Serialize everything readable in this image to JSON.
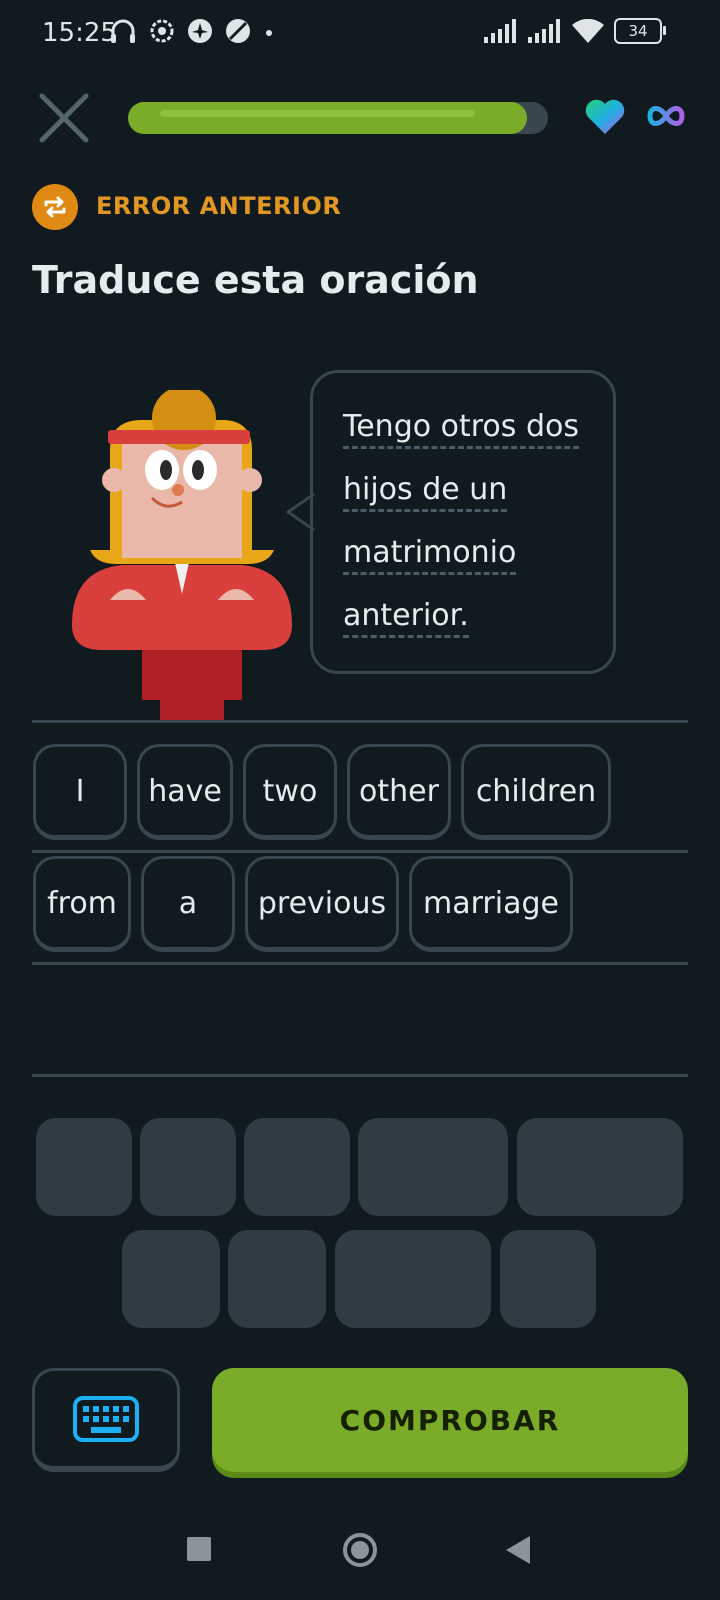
{
  "status_bar": {
    "time": "15:25",
    "battery": "34",
    "icons": [
      "headphones-icon",
      "settings-sync-icon",
      "airplane-mode-icon",
      "no-data-icon",
      "dot-icon",
      "signal-icon",
      "signal-icon",
      "wifi-icon",
      "battery-icon"
    ]
  },
  "top_bar": {
    "progress_fraction": 0.95,
    "icons": [
      "close-icon",
      "heart-icon",
      "infinity-icon"
    ],
    "colors": {
      "progress": "#7aac2a",
      "track": "#37464f"
    }
  },
  "header": {
    "badge_label": "ERROR ANTERIOR",
    "title": "Traduce esta oración",
    "badge_color": "#e08a15"
  },
  "prompt": {
    "lines": [
      "Tengo otros dos",
      "hijos de un",
      "matrimonio",
      "anterior."
    ]
  },
  "answer": {
    "row1": [
      "I",
      "have",
      "two",
      "other",
      "children"
    ],
    "row2": [
      "from",
      "a",
      "previous",
      "marriage"
    ]
  },
  "bottom": {
    "check_label": "COMPROBAR",
    "keyboard_icon": "keyboard-icon",
    "check_color": "#7aac2a"
  },
  "nav_bar": {
    "icons": [
      "recents-square-icon",
      "home-circle-icon",
      "back-triangle-icon"
    ]
  }
}
